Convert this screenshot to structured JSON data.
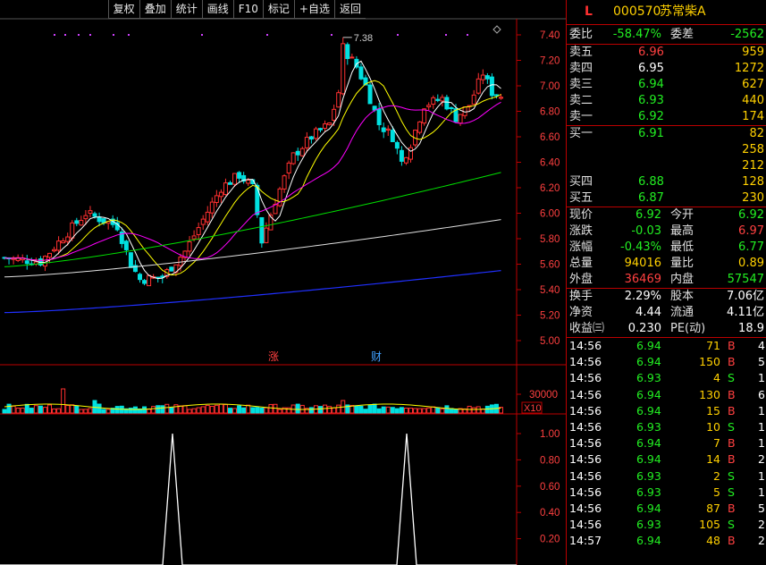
{
  "toolbar": {
    "items": [
      "复权",
      "叠加",
      "统计",
      "画线",
      "F10",
      "标记",
      "+自选",
      "返回"
    ]
  },
  "chart": {
    "price_ticks": [
      "7.40",
      "7.20",
      "7.00",
      "6.80",
      "6.60",
      "6.40",
      "6.20",
      "6.00",
      "5.80",
      "5.60",
      "5.40",
      "5.20",
      "5.00"
    ],
    "high_marker": "7.38",
    "event_marks": [
      "涨",
      "财"
    ],
    "volume_tick": "30000",
    "volume_unit": "X10",
    "indicator_ticks": [
      "1.00",
      "0.80",
      "0.60",
      "0.40",
      "0.20"
    ],
    "colors": {
      "up": "#ff3030",
      "down": "#00e0e0",
      "ma5": "#ffffff",
      "ma10": "#ffff00",
      "ma20": "#ff00ff",
      "ma60": "#00e000",
      "ma120": "#e0e0e0",
      "ma250": "#2030ff"
    }
  },
  "stock": {
    "flag": "L",
    "code": "000570",
    "name": "苏常柴A"
  },
  "order_book": {
    "weibi_label": "委比",
    "weibi": "-58.47%",
    "weicha_label": "委差",
    "weicha": "-2562",
    "asks": [
      {
        "label": "卖五",
        "price": "6.96",
        "vol": "959"
      },
      {
        "label": "卖四",
        "price": "6.95",
        "vol": "1272"
      },
      {
        "label": "卖三",
        "price": "6.94",
        "vol": "627"
      },
      {
        "label": "卖二",
        "price": "6.93",
        "vol": "440"
      },
      {
        "label": "卖一",
        "price": "6.92",
        "vol": "174"
      }
    ],
    "bids": [
      {
        "label": "买一",
        "price": "6.91",
        "vol": "82"
      },
      {
        "label": "",
        "price": "",
        "vol": "258"
      },
      {
        "label": "",
        "price": "",
        "vol": "212"
      },
      {
        "label": "买四",
        "price": "6.88",
        "vol": "128"
      },
      {
        "label": "买五",
        "price": "6.87",
        "vol": "230"
      }
    ]
  },
  "quote": {
    "now_label": "现价",
    "now": "6.92",
    "open_label": "今开",
    "open": "6.92",
    "chg_label": "涨跌",
    "chg": "-0.03",
    "high_label": "最高",
    "high": "6.97",
    "pct_label": "涨幅",
    "pct": "-0.43%",
    "low_label": "最低",
    "low": "6.77",
    "vol_label": "总量",
    "vol": "94016",
    "ratio_label": "量比",
    "ratio": "0.89",
    "out_label": "外盘",
    "out": "36469",
    "in_label": "内盘",
    "in": "57547"
  },
  "fundamentals": {
    "turnover_label": "换手",
    "turnover": "2.29%",
    "shares_label": "股本",
    "shares": "7.06亿",
    "netasset_label": "净资",
    "netasset": "4.44",
    "float_label": "流通",
    "float": "4.11亿",
    "eps_label": "收益㈢",
    "eps": "0.230",
    "pe_label": "PE(动)",
    "pe": "18.9"
  },
  "trades": [
    {
      "time": "14:56",
      "price": "6.94",
      "vol": "71",
      "side": "B",
      "n": "4"
    },
    {
      "time": "14:56",
      "price": "6.94",
      "vol": "150",
      "side": "B",
      "n": "5"
    },
    {
      "time": "14:56",
      "price": "6.93",
      "vol": "4",
      "side": "S",
      "n": "1"
    },
    {
      "time": "14:56",
      "price": "6.94",
      "vol": "130",
      "side": "B",
      "n": "6"
    },
    {
      "time": "14:56",
      "price": "6.94",
      "vol": "15",
      "side": "B",
      "n": "1"
    },
    {
      "time": "14:56",
      "price": "6.93",
      "vol": "10",
      "side": "S",
      "n": "1"
    },
    {
      "time": "14:56",
      "price": "6.94",
      "vol": "7",
      "side": "B",
      "n": "1"
    },
    {
      "time": "14:56",
      "price": "6.94",
      "vol": "14",
      "side": "B",
      "n": "2"
    },
    {
      "time": "14:56",
      "price": "6.93",
      "vol": "2",
      "side": "S",
      "n": "1"
    },
    {
      "time": "14:56",
      "price": "6.93",
      "vol": "5",
      "side": "S",
      "n": "1"
    },
    {
      "time": "14:56",
      "price": "6.94",
      "vol": "87",
      "side": "B",
      "n": "5"
    },
    {
      "time": "14:56",
      "price": "6.93",
      "vol": "105",
      "side": "S",
      "n": "2"
    },
    {
      "time": "14:57",
      "price": "6.94",
      "vol": "48",
      "side": "B",
      "n": "2"
    }
  ]
}
